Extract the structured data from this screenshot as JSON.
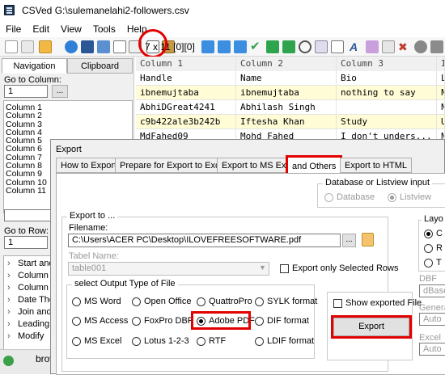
{
  "window": {
    "title": "CSVed G:\\sulemanelahi2-followers.csv"
  },
  "menu": [
    "File",
    "Edit",
    "View",
    "Tools",
    "Help"
  ],
  "toolbar": {
    "status": "7 x 11 [0][0]"
  },
  "left_panel": {
    "tabs": [
      "Navigation",
      "Clipboard"
    ],
    "goto_column_label": "Go to Column:",
    "goto_column_value": "1",
    "browse_label": "...",
    "columns": [
      "Column 1",
      "Column 2",
      "Column 3",
      "Column 4",
      "Column 5",
      "Column 6",
      "Column 7",
      "Column 8",
      "Column 9",
      "Column 10",
      "Column 11"
    ],
    "goto_row_label": "Go to Row:",
    "goto_row_value": "1",
    "actions": [
      "Start and",
      "Column E",
      "Column E",
      "Date Thou",
      "Join and S",
      "Leading Z",
      "Modify"
    ],
    "status_text": "brow"
  },
  "grid": {
    "headers": [
      "Column 1",
      "Column 2",
      "Column 3",
      "I"
    ],
    "rows": [
      [
        "Handle",
        "Name",
        "Bio",
        "L"
      ],
      [
        "ibnemujtaba",
        "ibnemujtaba",
        "nothing to say",
        "N"
      ],
      [
        "AbhiDGreat4241",
        "Abhilash Singh",
        "",
        "N"
      ],
      [
        "c9b422ale3b242b",
        "Iftesha Khan",
        "Study",
        "U"
      ],
      [
        "MdFahed09",
        "Mohd Fahed",
        "I don't unders...",
        "N"
      ]
    ]
  },
  "dialog": {
    "title": "Export",
    "tabs": [
      "How to Export",
      "Prepare for Export to Excel",
      "Export to MS Excel",
      "and Others",
      "Export to HTML"
    ],
    "db_group": {
      "title": "Database or Listview input",
      "options": [
        "Database",
        "Listview"
      ]
    },
    "export_to": {
      "title": "Export to ...",
      "filename_label": "Filename:",
      "filename_value": "C:\\Users\\ACER PC\\Desktop\\ILOVEFREESOFTWARE.pdf",
      "browse_label": "...",
      "table_name_label": "Tabel Name:",
      "table_name_value": "table001",
      "only_selected_label": "Export only Selected Rows"
    },
    "output_type": {
      "title": "select Output Type of File",
      "options": [
        [
          "MS Word",
          "Open Office",
          "QuattroPro",
          "SYLK format"
        ],
        [
          "MS Access",
          "FoxPro DBF",
          "Adobe PDF",
          "DIF format"
        ],
        [
          "MS Excel",
          "Lotus 1-2-3",
          "RTF",
          "LDIF format"
        ]
      ],
      "selected": "Adobe PDF"
    },
    "show_exported_label": "Show exported File",
    "export_button": "Export",
    "right_side": {
      "layout_label": "Layo",
      "layout_options": [
        "C",
        "R",
        "T"
      ],
      "dbf_label": "DBF Ve",
      "dbf_value": "dBase",
      "general_label": "Genera",
      "general_value": "Auto",
      "excel_label": "Excel V",
      "excel_value": "Auto"
    }
  }
}
